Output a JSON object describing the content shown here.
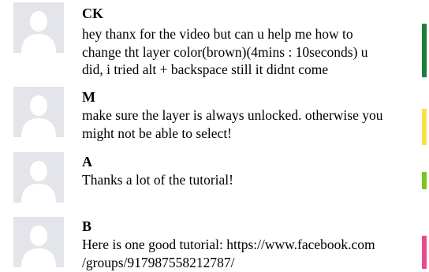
{
  "comments": [
    {
      "author": "CK",
      "text": "hey thanx for the video but can u help me how to\nchange tht layer color(brown)(4mins : 10seconds) u\ndid, i tried alt + backspace still it didnt come",
      "bar_color": "#1a7f37"
    },
    {
      "author": "M",
      "text": "make sure the layer is always unlocked. otherwise you\nmight not be able to select!",
      "bar_color": "#f6e14b"
    },
    {
      "author": "A",
      "text": "Thanks a lot of the tutorial!",
      "bar_color": "#7cc51d"
    },
    {
      "author": "B",
      "text": "Here is one good tutorial: https://www.facebook.com\n/groups/917987558212787/",
      "bar_color": "#e84b8a"
    }
  ],
  "avatar_icon": "default-user-silhouette-icon"
}
